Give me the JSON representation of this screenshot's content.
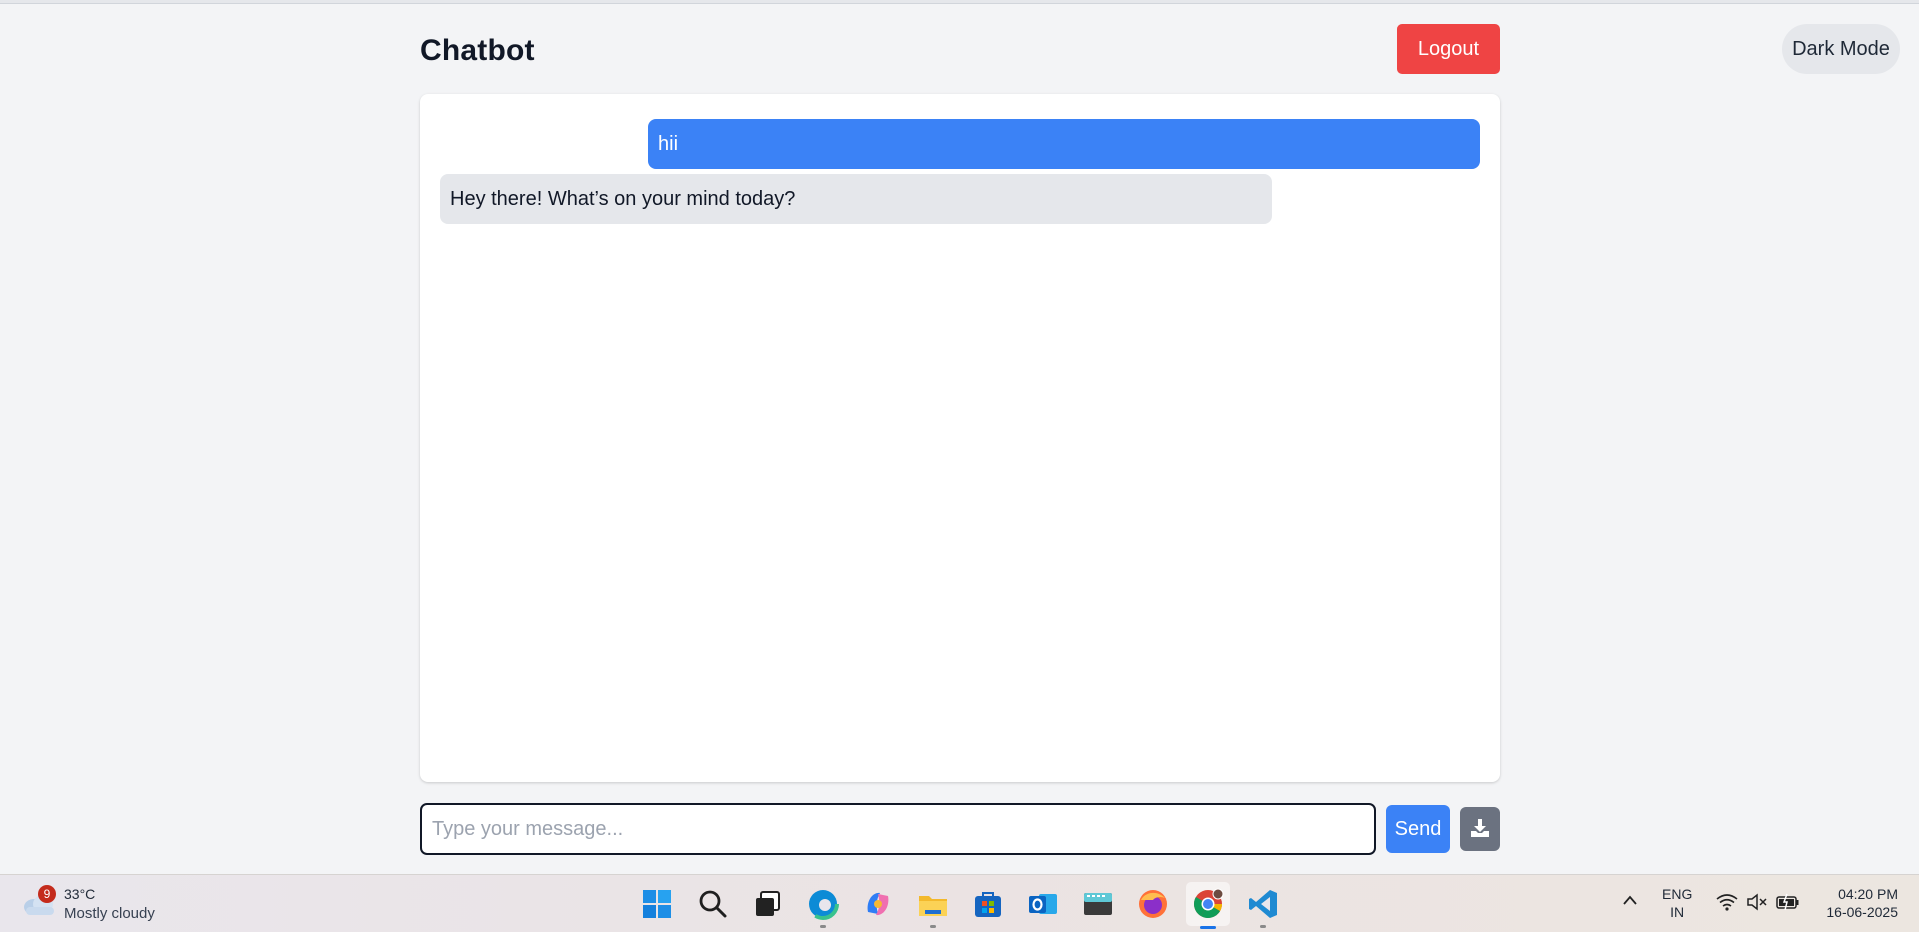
{
  "header": {
    "title": "Chatbot",
    "logout_label": "Logout",
    "dark_mode_label": "Dark Mode"
  },
  "chat": {
    "messages": [
      {
        "role": "user",
        "text": "hii"
      },
      {
        "role": "bot",
        "text": "Hey there! What’s on your mind today?"
      }
    ]
  },
  "composer": {
    "placeholder": "Type your message...",
    "value": "",
    "send_label": "Send",
    "download_icon": "download-icon"
  },
  "colors": {
    "accent_blue": "#3b82f6",
    "logout_red": "#ef4444",
    "bot_bubble": "#e5e7eb",
    "page_bg": "#f3f4f6"
  },
  "taskbar": {
    "weather": {
      "badge": "9",
      "temp": "33°C",
      "desc": "Mostly cloudy"
    },
    "apps": [
      "start-icon",
      "search-icon",
      "task-view-icon",
      "edge-icon",
      "copilot-icon",
      "file-explorer-icon",
      "store-icon",
      "outlook-icon",
      "terminal-icon",
      "firefox-icon",
      "chrome-icon",
      "vscode-icon"
    ],
    "tray": {
      "lang_line1": "ENG",
      "lang_line2": "IN",
      "time": "04:20 PM",
      "date": "16-06-2025"
    }
  }
}
